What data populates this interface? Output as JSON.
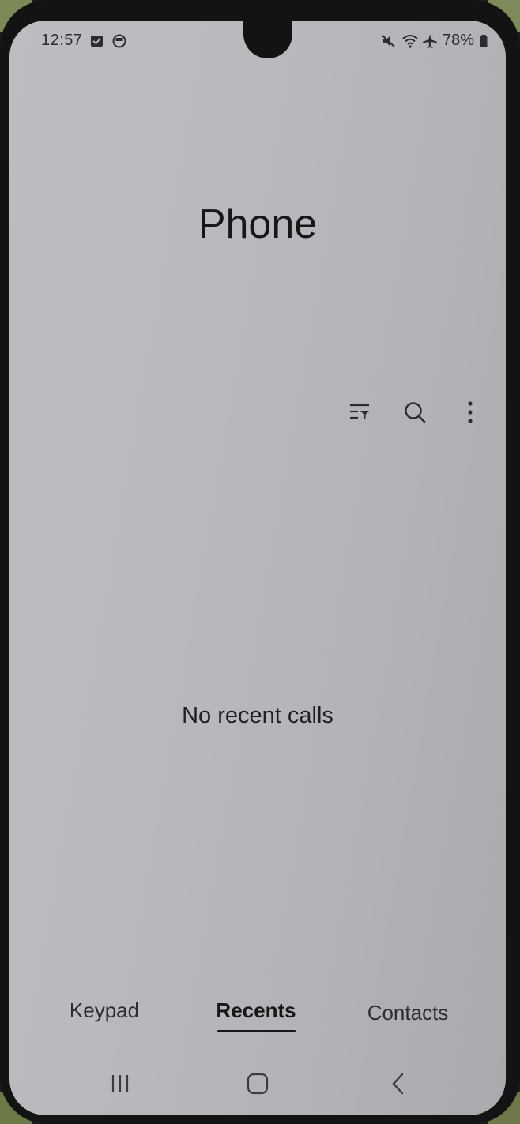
{
  "status_bar": {
    "time": "12:57",
    "battery": "78%",
    "left_icons": [
      "checkbox-notification-icon",
      "app-notification-icon"
    ],
    "right_icons": [
      "mute-icon",
      "wifi-icon",
      "airplane-icon",
      "battery-icon"
    ]
  },
  "header": {
    "title": "Phone"
  },
  "toolbar": {
    "buttons": [
      "filter-icon",
      "search-icon",
      "more-options-icon"
    ]
  },
  "main": {
    "empty_message": "No recent calls"
  },
  "tabs": [
    {
      "label": "Keypad",
      "active": false
    },
    {
      "label": "Recents",
      "active": true
    },
    {
      "label": "Contacts",
      "active": false
    }
  ],
  "nav_bar": {
    "buttons": [
      "recent-apps-icon",
      "home-icon",
      "back-icon"
    ]
  },
  "colors": {
    "screen_background": "#b9babe",
    "text_primary": "#161718"
  }
}
